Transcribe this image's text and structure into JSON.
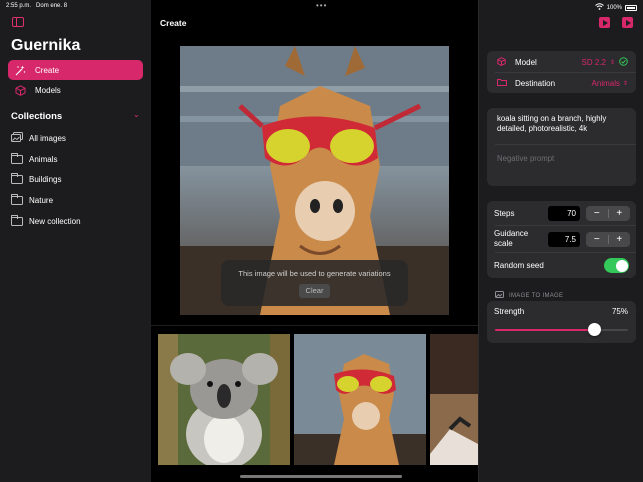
{
  "status_bar": {
    "time": "2:55 p.m.",
    "date": "Dom ene. 8",
    "battery": "100%"
  },
  "sidebar": {
    "app_title": "Guernika",
    "nav": [
      {
        "label": "Create",
        "icon": "sparkles-icon"
      },
      {
        "label": "Models",
        "icon": "cube-icon"
      }
    ],
    "collections_title": "Collections",
    "collections": [
      {
        "label": "All images"
      },
      {
        "label": "Animals"
      },
      {
        "label": "Buildings"
      },
      {
        "label": "Nature"
      },
      {
        "label": "New collection"
      }
    ],
    "accent": "#d6286a"
  },
  "main": {
    "title": "Create",
    "overlay_text": "This image will be used to generate variations",
    "clear_label": "Clear",
    "thumbnails": [
      {
        "subject": "koala"
      },
      {
        "subject": "giraffe"
      },
      {
        "subject": "partial"
      }
    ]
  },
  "panel": {
    "model_label": "Model",
    "model_value": "SD 2.2",
    "destination_label": "Destination",
    "destination_value": "Animals",
    "prompt": "koala sitting on a branch, highly detailed, photorealistic, 4k",
    "negative_placeholder": "Negative prompt",
    "steps_label": "Steps",
    "steps_value": "70",
    "guidance_label": "Guidance scale",
    "guidance_value": "7.5",
    "random_seed_label": "Random seed",
    "random_seed_on": true,
    "img2img_header": "IMAGE TO IMAGE",
    "strength_label": "Strength",
    "strength_value": "75%",
    "strength_fraction": 0.75,
    "minus": "−",
    "plus": "+"
  }
}
